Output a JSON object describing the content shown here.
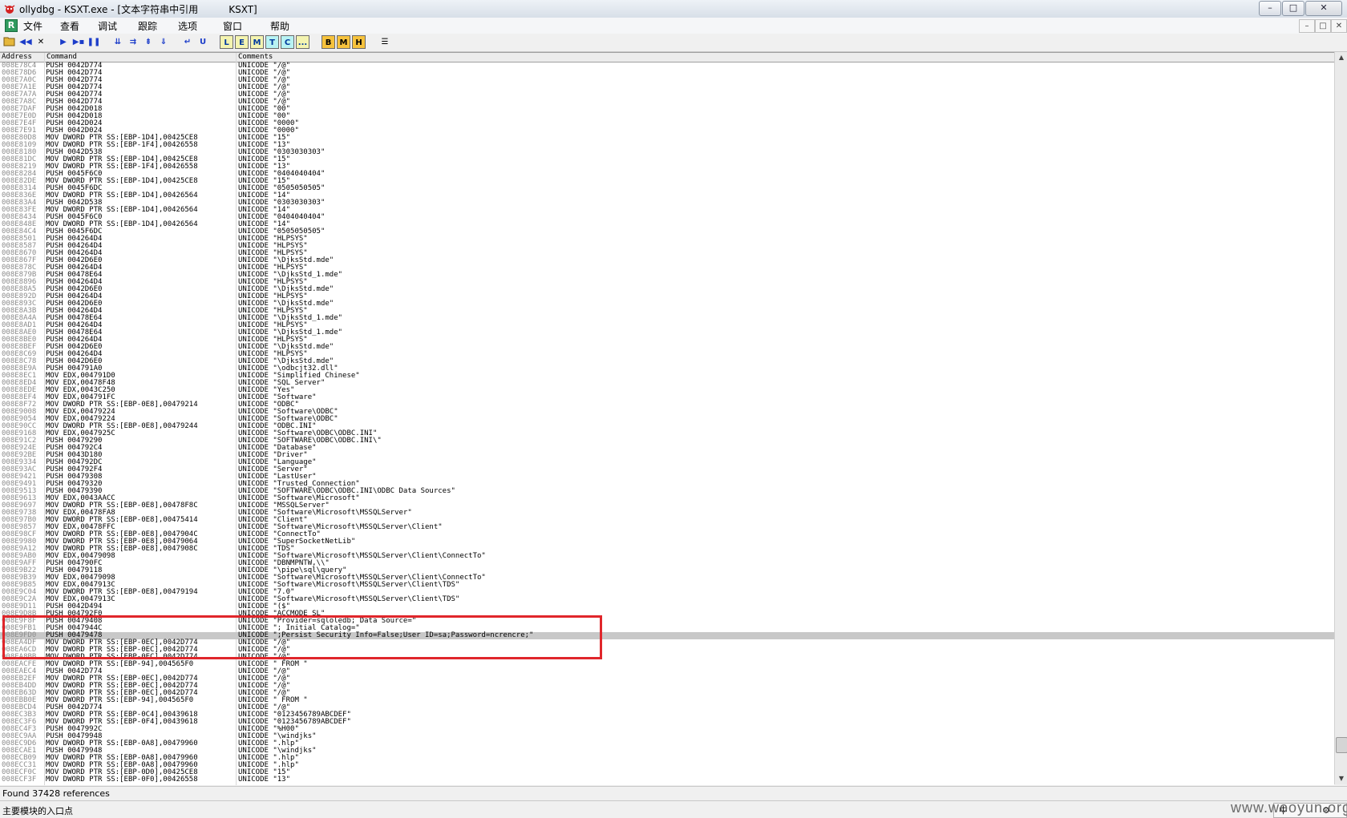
{
  "window": {
    "title": "ollydbg - KSXT.exe - [文本字符串中引用          KSXT]",
    "minimize_glyph": "–",
    "maximize_glyph": "□",
    "close_glyph": "✕"
  },
  "menu": {
    "icon_letter": "R",
    "items": [
      "文件",
      "查看",
      "调试",
      "跟踪",
      "选项",
      "窗口",
      "帮助"
    ]
  },
  "toolbar": {
    "letters": [
      "L",
      "E",
      "M",
      "T",
      "C",
      "...",
      "B",
      "M",
      "H"
    ]
  },
  "table": {
    "headers": [
      "Address",
      "Command",
      "Comments"
    ],
    "rows": [
      {
        "a": "008E78C4",
        "c": "PUSH 0042D774",
        "m": "UNICODE \"/@\""
      },
      {
        "a": "008E78D6",
        "c": "PUSH 0042D774",
        "m": "UNICODE \"/@\""
      },
      {
        "a": "008E7A0C",
        "c": "PUSH 0042D774",
        "m": "UNICODE \"/@\""
      },
      {
        "a": "008E7A1E",
        "c": "PUSH 0042D774",
        "m": "UNICODE \"/@\""
      },
      {
        "a": "008E7A7A",
        "c": "PUSH 0042D774",
        "m": "UNICODE \"/@\""
      },
      {
        "a": "008E7A8C",
        "c": "PUSH 0042D774",
        "m": "UNICODE \"/@\""
      },
      {
        "a": "008E7DAF",
        "c": "PUSH 0042D018",
        "m": "UNICODE \"00\""
      },
      {
        "a": "008E7E0D",
        "c": "PUSH 0042D018",
        "m": "UNICODE \"00\""
      },
      {
        "a": "008E7E4F",
        "c": "PUSH 0042D024",
        "m": "UNICODE \"0000\""
      },
      {
        "a": "008E7E91",
        "c": "PUSH 0042D024",
        "m": "UNICODE \"0000\""
      },
      {
        "a": "008E80D8",
        "c": "MOV DWORD PTR SS:[EBP-1D4],00425CE8",
        "m": "UNICODE \"15\""
      },
      {
        "a": "008E8109",
        "c": "MOV DWORD PTR SS:[EBP-1F4],00426558",
        "m": "UNICODE \"13\""
      },
      {
        "a": "008E8180",
        "c": "PUSH 0042D538",
        "m": "UNICODE \"0303030303\""
      },
      {
        "a": "008E81DC",
        "c": "MOV DWORD PTR SS:[EBP-1D4],00425CE8",
        "m": "UNICODE \"15\""
      },
      {
        "a": "008E8219",
        "c": "MOV DWORD PTR SS:[EBP-1F4],00426558",
        "m": "UNICODE \"13\""
      },
      {
        "a": "008E8284",
        "c": "PUSH 0045F6C0",
        "m": "UNICODE \"0404040404\""
      },
      {
        "a": "008E82DE",
        "c": "MOV DWORD PTR SS:[EBP-1D4],00425CE8",
        "m": "UNICODE \"15\""
      },
      {
        "a": "008E8314",
        "c": "PUSH 0045F6DC",
        "m": "UNICODE \"0505050505\""
      },
      {
        "a": "008E836E",
        "c": "MOV DWORD PTR SS:[EBP-1D4],00426564",
        "m": "UNICODE \"14\""
      },
      {
        "a": "008E83A4",
        "c": "PUSH 0042D538",
        "m": "UNICODE \"0303030303\""
      },
      {
        "a": "008E83FE",
        "c": "MOV DWORD PTR SS:[EBP-1D4],00426564",
        "m": "UNICODE \"14\""
      },
      {
        "a": "008E8434",
        "c": "PUSH 0045F6C0",
        "m": "UNICODE \"0404040404\""
      },
      {
        "a": "008E848E",
        "c": "MOV DWORD PTR SS:[EBP-1D4],00426564",
        "m": "UNICODE \"14\""
      },
      {
        "a": "008E84C4",
        "c": "PUSH 0045F6DC",
        "m": "UNICODE \"0505050505\""
      },
      {
        "a": "008E8501",
        "c": "PUSH 004264D4",
        "m": "UNICODE \"HLPSYS\""
      },
      {
        "a": "008E8587",
        "c": "PUSH 004264D4",
        "m": "UNICODE \"HLPSYS\""
      },
      {
        "a": "008E8670",
        "c": "PUSH 004264D4",
        "m": "UNICODE \"HLPSYS\""
      },
      {
        "a": "008E867F",
        "c": "PUSH 0042D6E0",
        "m": "UNICODE \"\\DjksStd.mde\""
      },
      {
        "a": "008E878C",
        "c": "PUSH 004264D4",
        "m": "UNICODE \"HLPSYS\""
      },
      {
        "a": "008E879B",
        "c": "PUSH 00478E64",
        "m": "UNICODE \"\\DjksStd_1.mde\""
      },
      {
        "a": "008E8896",
        "c": "PUSH 004264D4",
        "m": "UNICODE \"HLPSYS\""
      },
      {
        "a": "008E88A5",
        "c": "PUSH 0042D6E0",
        "m": "UNICODE \"\\DjksStd.mde\""
      },
      {
        "a": "008E892D",
        "c": "PUSH 004264D4",
        "m": "UNICODE \"HLPSYS\""
      },
      {
        "a": "008E893C",
        "c": "PUSH 0042D6E0",
        "m": "UNICODE \"\\DjksStd.mde\""
      },
      {
        "a": "008E8A3B",
        "c": "PUSH 004264D4",
        "m": "UNICODE \"HLPSYS\""
      },
      {
        "a": "008E8A4A",
        "c": "PUSH 00478E64",
        "m": "UNICODE \"\\DjksStd_1.mde\""
      },
      {
        "a": "008E8AD1",
        "c": "PUSH 004264D4",
        "m": "UNICODE \"HLPSYS\""
      },
      {
        "a": "008E8AE0",
        "c": "PUSH 00478E64",
        "m": "UNICODE \"\\DjksStd_1.mde\""
      },
      {
        "a": "008E8BE0",
        "c": "PUSH 004264D4",
        "m": "UNICODE \"HLPSYS\""
      },
      {
        "a": "008E8BEF",
        "c": "PUSH 0042D6E0",
        "m": "UNICODE \"\\DjksStd.mde\""
      },
      {
        "a": "008E8C69",
        "c": "PUSH 004264D4",
        "m": "UNICODE \"HLPSYS\""
      },
      {
        "a": "008E8C78",
        "c": "PUSH 0042D6E0",
        "m": "UNICODE \"\\DjksStd.mde\""
      },
      {
        "a": "008E8E9A",
        "c": "PUSH 004791A0",
        "m": "UNICODE \"\\odbcjt32.dll\""
      },
      {
        "a": "008E8EC1",
        "c": "MOV EDX,004791D0",
        "m": "UNICODE \"Simplified Chinese\""
      },
      {
        "a": "008E8ED4",
        "c": "MOV EDX,00478F48",
        "m": "UNICODE \"SQL Server\""
      },
      {
        "a": "008E8EDE",
        "c": "MOV EDX,0043C250",
        "m": "UNICODE \"Yes\""
      },
      {
        "a": "008E8EF4",
        "c": "MOV EDX,004791FC",
        "m": "UNICODE \"Software\""
      },
      {
        "a": "008E8F72",
        "c": "MOV DWORD PTR SS:[EBP-0E8],00479214",
        "m": "UNICODE \"ODBC\""
      },
      {
        "a": "008E9008",
        "c": "MOV EDX,00479224",
        "m": "UNICODE \"Software\\ODBC\""
      },
      {
        "a": "008E9054",
        "c": "MOV EDX,00479224",
        "m": "UNICODE \"Software\\ODBC\""
      },
      {
        "a": "008E90CC",
        "c": "MOV DWORD PTR SS:[EBP-0E8],00479244",
        "m": "UNICODE \"ODBC.INI\""
      },
      {
        "a": "008E9168",
        "c": "MOV EDX,0047925C",
        "m": "UNICODE \"Software\\ODBC\\ODBC.INI\""
      },
      {
        "a": "008E91C2",
        "c": "PUSH 00479290",
        "m": "UNICODE \"SOFTWARE\\ODBC\\ODBC.INI\\\""
      },
      {
        "a": "008E924E",
        "c": "PUSH 004792C4",
        "m": "UNICODE \"Database\""
      },
      {
        "a": "008E92BE",
        "c": "PUSH 0043D180",
        "m": "UNICODE \"Driver\""
      },
      {
        "a": "008E9334",
        "c": "PUSH 004792DC",
        "m": "UNICODE \"Language\""
      },
      {
        "a": "008E93AC",
        "c": "PUSH 004792F4",
        "m": "UNICODE \"Server\""
      },
      {
        "a": "008E9421",
        "c": "PUSH 00479308",
        "m": "UNICODE \"LastUser\""
      },
      {
        "a": "008E9491",
        "c": "PUSH 00479320",
        "m": "UNICODE \"Trusted_Connection\""
      },
      {
        "a": "008E9513",
        "c": "PUSH 00479390",
        "m": "UNICODE \"SOFTWARE\\ODBC\\ODBC.INI\\ODBC Data Sources\""
      },
      {
        "a": "008E9613",
        "c": "MOV EDX,0043AACC",
        "m": "UNICODE \"Software\\Microsoft\""
      },
      {
        "a": "008E9697",
        "c": "MOV DWORD PTR SS:[EBP-0E8],00478F8C",
        "m": "UNICODE \"MSSQLServer\""
      },
      {
        "a": "008E9738",
        "c": "MOV EDX,00478FA8",
        "m": "UNICODE \"Software\\Microsoft\\MSSQLServer\""
      },
      {
        "a": "008E97B0",
        "c": "MOV DWORD PTR SS:[EBP-0E8],00475414",
        "m": "UNICODE \"Client\""
      },
      {
        "a": "008E9857",
        "c": "MOV EDX,00478FFC",
        "m": "UNICODE \"Software\\Microsoft\\MSSQLServer\\Client\""
      },
      {
        "a": "008E98CF",
        "c": "MOV DWORD PTR SS:[EBP-0E8],0047904C",
        "m": "UNICODE \"ConnectTo\""
      },
      {
        "a": "008E9980",
        "c": "MOV DWORD PTR SS:[EBP-0E8],00479064",
        "m": "UNICODE \"SuperSocketNetLib\""
      },
      {
        "a": "008E9A12",
        "c": "MOV DWORD PTR SS:[EBP-0E8],0047908C",
        "m": "UNICODE \"TDS\""
      },
      {
        "a": "008E9AB0",
        "c": "MOV EDX,00479098",
        "m": "UNICODE \"Software\\Microsoft\\MSSQLServer\\Client\\ConnectTo\""
      },
      {
        "a": "008E9AFF",
        "c": "PUSH 004790FC",
        "m": "UNICODE \"DBNMPNTW,\\\\\""
      },
      {
        "a": "008E9B22",
        "c": "PUSH 00479118",
        "m": "UNICODE \"\\pipe\\sql\\query\""
      },
      {
        "a": "008E9B39",
        "c": "MOV EDX,00479098",
        "m": "UNICODE \"Software\\Microsoft\\MSSQLServer\\Client\\ConnectTo\""
      },
      {
        "a": "008E9B85",
        "c": "MOV EDX,0047913C",
        "m": "UNICODE \"Software\\Microsoft\\MSSQLServer\\Client\\TDS\""
      },
      {
        "a": "008E9C04",
        "c": "MOV DWORD PTR SS:[EBP-0E8],00479194",
        "m": "UNICODE \"7.0\""
      },
      {
        "a": "008E9C2A",
        "c": "MOV EDX,0047913C",
        "m": "UNICODE \"Software\\Microsoft\\MSSQLServer\\Client\\TDS\""
      },
      {
        "a": "008E9D11",
        "c": "PUSH 0042D494",
        "m": "UNICODE \"($\""
      },
      {
        "a": "008E9D8B",
        "c": "PUSH 004792F0",
        "m": "UNICODE \"ACCMODE SL\""
      },
      {
        "a": "008E9F8F",
        "c": "PUSH 00479408",
        "m": "UNICODE \"Provider=sqloledb; Data Source=\""
      },
      {
        "a": "008E9FB1",
        "c": "PUSH 0047944C",
        "m": "UNICODE \"; Initial Catalog=\""
      },
      {
        "a": "008E9FD0",
        "c": "PUSH 00479478",
        "m": "UNICODE \";Persist Security Info=False;User ID=sa;Password=ncrencre;\"",
        "sel": true
      },
      {
        "a": "008EA4DF",
        "c": "MOV DWORD PTR SS:[EBP-0EC],0042D774",
        "m": "UNICODE \"/@\""
      },
      {
        "a": "008EA6CD",
        "c": "MOV DWORD PTR SS:[EBP-0EC],0042D774",
        "m": "UNICODE \"/@\""
      },
      {
        "a": "008EA8BB",
        "c": "MOV DWORD PTR SS:[EBP-0EC],0042D774",
        "m": "UNICODE \"/@\""
      },
      {
        "a": "008EACFE",
        "c": "MOV DWORD PTR SS:[EBP-94],004565F0",
        "m": "UNICODE \" FROM \""
      },
      {
        "a": "008EAEC4",
        "c": "PUSH 0042D774",
        "m": "UNICODE \"/@\""
      },
      {
        "a": "008EB2EF",
        "c": "MOV DWORD PTR SS:[EBP-0EC],0042D774",
        "m": "UNICODE \"/@\""
      },
      {
        "a": "008EB4DD",
        "c": "MOV DWORD PTR SS:[EBP-0EC],0042D774",
        "m": "UNICODE \"/@\""
      },
      {
        "a": "008EB63D",
        "c": "MOV DWORD PTR SS:[EBP-0EC],0042D774",
        "m": "UNICODE \"/@\""
      },
      {
        "a": "008EBB0E",
        "c": "MOV DWORD PTR SS:[EBP-94],004565F0",
        "m": "UNICODE \" FROM \""
      },
      {
        "a": "008EBCD4",
        "c": "PUSH 0042D774",
        "m": "UNICODE \"/@\""
      },
      {
        "a": "008EC3B3",
        "c": "MOV DWORD PTR SS:[EBP-0C4],00439618",
        "m": "UNICODE \"0123456789ABCDEF\""
      },
      {
        "a": "008EC3F6",
        "c": "MOV DWORD PTR SS:[EBP-0F4],00439618",
        "m": "UNICODE \"0123456789ABCDEF\""
      },
      {
        "a": "008EC4F3",
        "c": "PUSH 0047992C",
        "m": "UNICODE \"%H00\""
      },
      {
        "a": "008EC9AA",
        "c": "PUSH 00479948",
        "m": "UNICODE \"\\windjks\""
      },
      {
        "a": "008EC9D6",
        "c": "MOV DWORD PTR SS:[EBP-0A8],00479960",
        "m": "UNICODE \".hlp\""
      },
      {
        "a": "008ECAE1",
        "c": "PUSH 00479948",
        "m": "UNICODE \"\\windjks\""
      },
      {
        "a": "008ECB09",
        "c": "MOV DWORD PTR SS:[EBP-0A8],00479960",
        "m": "UNICODE \".hlp\""
      },
      {
        "a": "008ECC31",
        "c": "MOV DWORD PTR SS:[EBP-0A8],00479960",
        "m": "UNICODE \".hlp\""
      },
      {
        "a": "008ECF0C",
        "c": "MOV DWORD PTR SS:[EBP-0D0],00425CE8",
        "m": "UNICODE \"15\""
      },
      {
        "a": "008ECF3F",
        "c": "MOV DWORD PTR SS:[EBP-0F0],00426558",
        "m": "UNICODE \"13\""
      }
    ]
  },
  "found_text": "Found 37428 references",
  "status_text": "主要模块的入口点",
  "ime_text": "中",
  "watermark": "www.wooyun.org",
  "colors": {
    "highlight_border": "#e0262b",
    "selected_row": "#c8c8c8",
    "address_text": "#8c8c8c"
  }
}
